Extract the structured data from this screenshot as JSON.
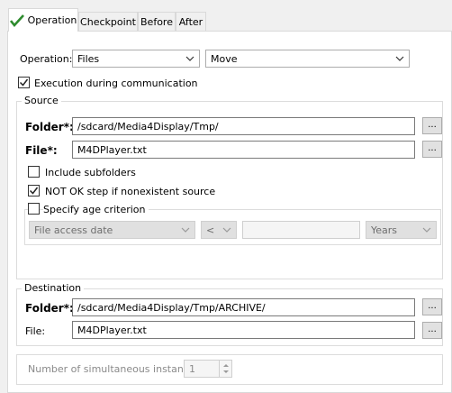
{
  "tabs": [
    {
      "label": "Operation"
    },
    {
      "label": "Checkpoint"
    },
    {
      "label": "Before"
    },
    {
      "label": "After"
    }
  ],
  "operation": {
    "label": "Operation:",
    "type_value": "Files",
    "action_value": "Move"
  },
  "execution_during_communication": {
    "label": "Execution during communication",
    "checked": true
  },
  "source": {
    "legend": "Source",
    "folder_label": "Folder*:",
    "folder_value": "/sdcard/Media4Display/Tmp/",
    "file_label": "File*:",
    "file_value": "M4DPlayer.txt",
    "browse_label": "...",
    "include_subfolders": {
      "label": "Include subfolders",
      "checked": false
    },
    "not_ok_nonexistent": {
      "label": "NOT OK step if nonexistent source",
      "checked": true
    },
    "age_criterion": {
      "label": "Specify age criterion",
      "checked": false,
      "date_type": "File access date",
      "comparator": "<",
      "amount": "",
      "unit": "Years"
    }
  },
  "destination": {
    "legend": "Destination",
    "folder_label": "Folder*:",
    "folder_value": "/sdcard/Media4Display/Tmp/ARCHIVE/",
    "file_label": "File:",
    "file_value": "M4DPlayer.txt",
    "browse_label": "..."
  },
  "instances": {
    "label": "Number of simultaneous instances:",
    "value": "1"
  },
  "colors": {
    "accent_check": "#2e8b2e",
    "panel_bg": "#ffffff",
    "window_bg": "#f0f0f0"
  }
}
